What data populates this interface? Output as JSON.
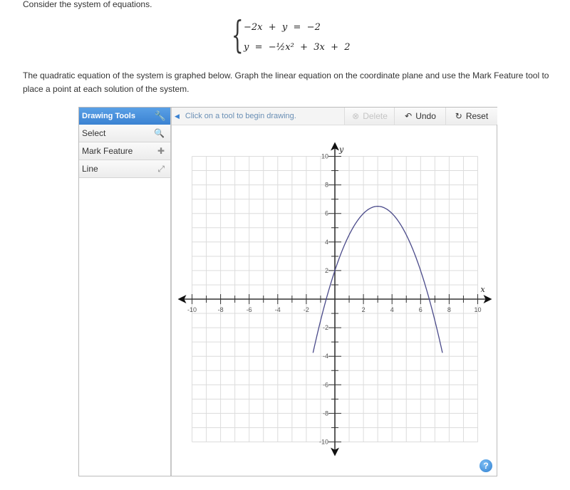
{
  "intro": "Consider the system of equations.",
  "equations": {
    "line1": "−2x  +  y  =  −2",
    "line2": "y  =  −½x²  +  3x  +  2"
  },
  "instructions": "The quadratic equation of the system is graphed below. Graph the linear equation on the coordinate plane and use the Mark Feature tool to place a point at each solution of the system.",
  "sidebar": {
    "title": "Drawing Tools",
    "title_icon": "wrench-icon",
    "items": [
      {
        "label": "Select",
        "icon": "select-cursor-icon"
      },
      {
        "label": "Mark Feature",
        "icon": "plus-icon"
      },
      {
        "label": "Line",
        "icon": "double-arrow-icon"
      }
    ]
  },
  "toolbar": {
    "hint": "Click on a tool to begin drawing.",
    "delete_label": "Delete",
    "undo_label": "Undo",
    "reset_label": "Reset"
  },
  "help_label": "?",
  "chart_data": {
    "type": "line",
    "title": "",
    "xlabel": "x",
    "ylabel": "y",
    "xlim": [
      -10,
      10
    ],
    "ylim": [
      -10,
      10
    ],
    "grid": true,
    "x_tick_labels": [
      "-10",
      "-8",
      "-6",
      "-4",
      "-2",
      "2",
      "4",
      "6",
      "8",
      "10"
    ],
    "y_tick_labels": [
      "10",
      "8",
      "6",
      "4",
      "2",
      "-2",
      "-4",
      "-6",
      "-8",
      "-10"
    ],
    "series": [
      {
        "name": "y = -1/2 x^2 + 3x + 2",
        "function": {
          "a": -0.5,
          "b": 3,
          "c": 2
        },
        "color": "#4a4a8a",
        "x_range": [
          -1.53,
          7.53
        ]
      }
    ]
  }
}
